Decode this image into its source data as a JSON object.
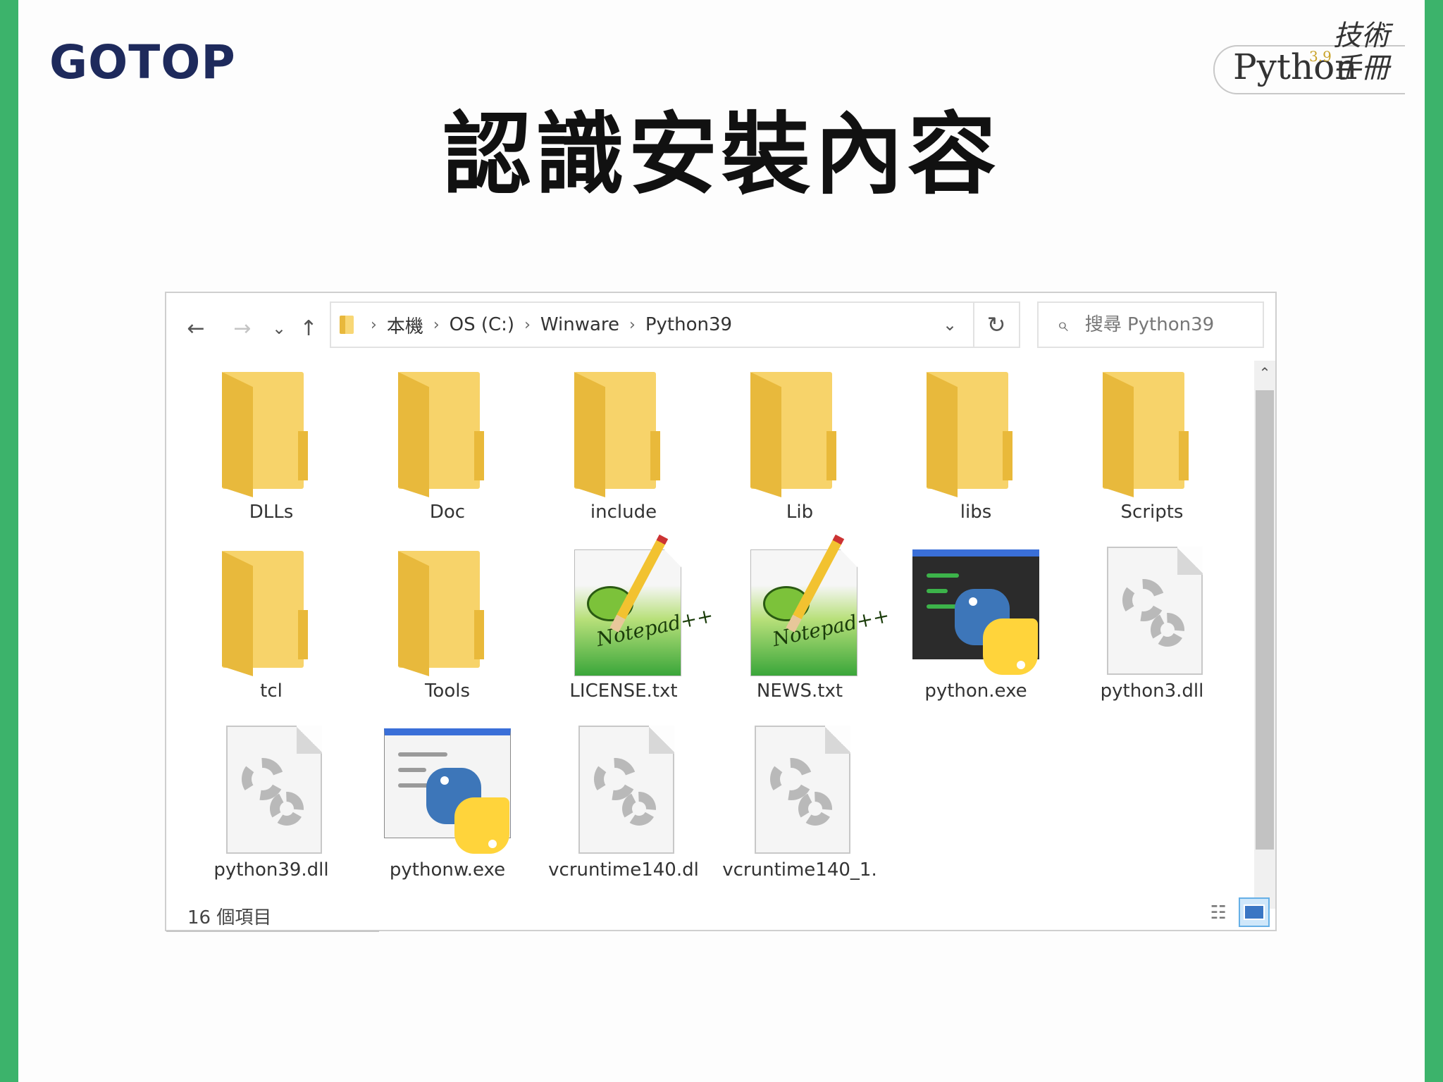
{
  "slide": {
    "brand": "GOTOP",
    "title": "認識安裝內容",
    "book_badge": {
      "name": "Python",
      "version": "3.9",
      "subtitle": "技術手冊"
    }
  },
  "explorer": {
    "nav": {
      "back": "←",
      "forward": "→",
      "recent": "⌄",
      "up": "↑"
    },
    "breadcrumb": [
      "本機",
      "OS (C:)",
      "Winware",
      "Python39"
    ],
    "refresh": "↻",
    "search_placeholder": "搜尋 Python39",
    "items": [
      {
        "name": "DLLs",
        "type": "folder"
      },
      {
        "name": "Doc",
        "type": "folder"
      },
      {
        "name": "include",
        "type": "folder"
      },
      {
        "name": "Lib",
        "type": "folder"
      },
      {
        "name": "libs",
        "type": "folder"
      },
      {
        "name": "Scripts",
        "type": "folder"
      },
      {
        "name": "tcl",
        "type": "folder"
      },
      {
        "name": "Tools",
        "type": "folder"
      },
      {
        "name": "LICENSE.txt",
        "type": "notepad"
      },
      {
        "name": "NEWS.txt",
        "type": "notepad"
      },
      {
        "name": "python.exe",
        "type": "python-console"
      },
      {
        "name": "python3.dll",
        "type": "dll"
      },
      {
        "name": "python39.dll",
        "type": "dll"
      },
      {
        "name": "pythonw.exe",
        "type": "python-window"
      },
      {
        "name": "vcruntime140.dl",
        "type": "dll"
      },
      {
        "name": "vcruntime140_1.",
        "type": "dll"
      }
    ],
    "status": "16 個項目",
    "colors": {
      "accent_green": "#3cb36b",
      "brand_navy": "#1e2a5c",
      "folder": "#f7d36a",
      "view_selected": "#cfe7fa"
    }
  }
}
